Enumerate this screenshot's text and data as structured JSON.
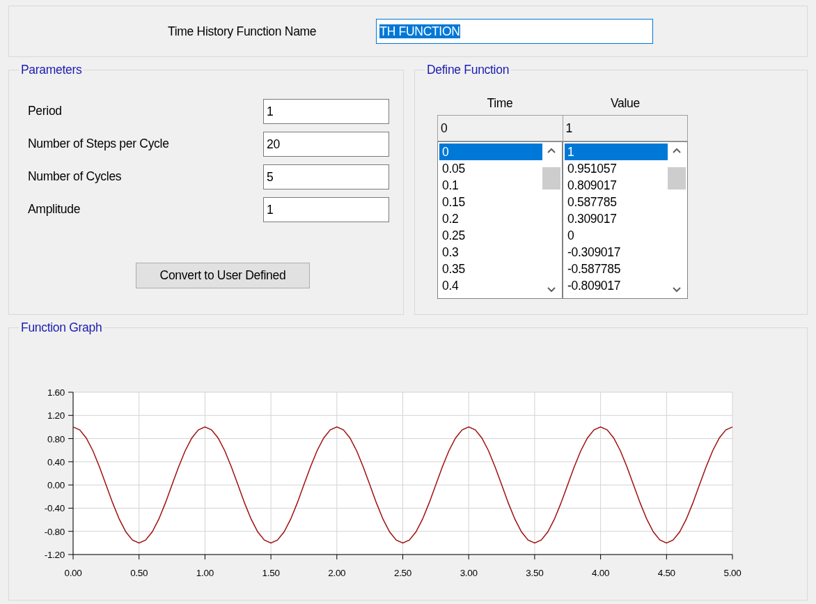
{
  "name_row": {
    "label": "Time History Function Name",
    "value": "TH FUNCTION",
    "focused": true,
    "text_selected": true
  },
  "parameters": {
    "title": "Parameters",
    "fields": [
      {
        "label": "Period",
        "value": "1"
      },
      {
        "label": "Number of Steps per Cycle",
        "value": "20"
      },
      {
        "label": "Number of Cycles",
        "value": "5"
      },
      {
        "label": "Amplitude",
        "value": "1"
      }
    ],
    "button": "Convert to User Defined"
  },
  "define_function": {
    "title": "Define Function",
    "columns": [
      "Time",
      "Value"
    ],
    "edit_row": [
      "0",
      "1"
    ],
    "time_list": [
      {
        "text": "0",
        "selected": true
      },
      {
        "text": "0.05",
        "selected": false
      },
      {
        "text": "0.1",
        "selected": false
      },
      {
        "text": "0.15",
        "selected": false
      },
      {
        "text": "0.2",
        "selected": false
      },
      {
        "text": "0.25",
        "selected": false
      },
      {
        "text": "0.3",
        "selected": false
      },
      {
        "text": "0.35",
        "selected": false
      },
      {
        "text": "0.4",
        "selected": false
      }
    ],
    "value_list": [
      {
        "text": "1",
        "selected": true
      },
      {
        "text": "0.951057",
        "selected": false
      },
      {
        "text": "0.809017",
        "selected": false
      },
      {
        "text": "0.587785",
        "selected": false
      },
      {
        "text": "0.309017",
        "selected": false
      },
      {
        "text": "0",
        "selected": false
      },
      {
        "text": "-0.309017",
        "selected": false
      },
      {
        "text": "-0.587785",
        "selected": false
      },
      {
        "text": "-0.809017",
        "selected": false
      }
    ]
  },
  "function_graph": {
    "title": "Function Graph",
    "chart_data": {
      "type": "line",
      "x": [
        0,
        0.05,
        0.1,
        0.15,
        0.2,
        0.25,
        0.3,
        0.35,
        0.4,
        0.45,
        0.5,
        0.55,
        0.6,
        0.65,
        0.7,
        0.75,
        0.8,
        0.85,
        0.9,
        0.95,
        1,
        1.05,
        1.1,
        1.15,
        1.2,
        1.25,
        1.3,
        1.35,
        1.4,
        1.45,
        1.5,
        1.55,
        1.6,
        1.65,
        1.7,
        1.75,
        1.8,
        1.85,
        1.9,
        1.95,
        2,
        2.05,
        2.1,
        2.15,
        2.2,
        2.25,
        2.3,
        2.35,
        2.4,
        2.45,
        2.5,
        2.55,
        2.6,
        2.65,
        2.7,
        2.75,
        2.8,
        2.85,
        2.9,
        2.95,
        3,
        3.05,
        3.1,
        3.15,
        3.2,
        3.25,
        3.3,
        3.35,
        3.4,
        3.45,
        3.5,
        3.55,
        3.6,
        3.65,
        3.7,
        3.75,
        3.8,
        3.85,
        3.9,
        3.95,
        4,
        4.05,
        4.1,
        4.15,
        4.2,
        4.25,
        4.3,
        4.35,
        4.4,
        4.45,
        4.5,
        4.55,
        4.6,
        4.65,
        4.7,
        4.75,
        4.8,
        4.85,
        4.9,
        4.95,
        5
      ],
      "grid": true,
      "series": [
        {
          "color": "#a01010",
          "values": [
            1,
            0.95,
            0.81,
            0.59,
            0.31,
            0,
            -0.31,
            -0.59,
            -0.81,
            -0.95,
            -1,
            -0.95,
            -0.81,
            -0.59,
            -0.31,
            0,
            0.31,
            0.59,
            0.81,
            0.95,
            1,
            0.95,
            0.81,
            0.59,
            0.31,
            0,
            -0.31,
            -0.59,
            -0.81,
            -0.95,
            -1,
            -0.95,
            -0.81,
            -0.59,
            -0.31,
            0,
            0.31,
            0.59,
            0.81,
            0.95,
            1,
            0.95,
            0.81,
            0.59,
            0.31,
            0,
            -0.31,
            -0.59,
            -0.81,
            -0.95,
            -1,
            -0.95,
            -0.81,
            -0.59,
            -0.31,
            0,
            0.31,
            0.59,
            0.81,
            0.95,
            1,
            0.95,
            0.81,
            0.59,
            0.31,
            0,
            -0.31,
            -0.59,
            -0.81,
            -0.95,
            -1,
            -0.95,
            -0.81,
            -0.59,
            -0.31,
            0,
            0.31,
            0.59,
            0.81,
            0.95,
            1,
            0.95,
            0.81,
            0.59,
            0.31,
            0,
            -0.31,
            -0.59,
            -0.81,
            -0.95,
            -1,
            -0.95,
            -0.81,
            -0.59,
            -0.31,
            0,
            0.31,
            0.59,
            0.81,
            0.95,
            1
          ]
        }
      ],
      "xlim": [
        0,
        5
      ],
      "ylim": [
        -1.2,
        1.6
      ],
      "xticks": [
        {
          "value": 0,
          "label": "0.00"
        },
        {
          "value": 0.5,
          "label": "0.50"
        },
        {
          "value": 1,
          "label": "1.00"
        },
        {
          "value": 1.5,
          "label": "1.50"
        },
        {
          "value": 2,
          "label": "2.00"
        },
        {
          "value": 2.5,
          "label": "2.50"
        },
        {
          "value": 3,
          "label": "3.00"
        },
        {
          "value": 3.5,
          "label": "3.50"
        },
        {
          "value": 4,
          "label": "4.00"
        },
        {
          "value": 4.5,
          "label": "4.50"
        },
        {
          "value": 5,
          "label": "5.00"
        }
      ],
      "yticks": [
        {
          "value": -1.2,
          "label": "-1.20"
        },
        {
          "value": -0.8,
          "label": "-0.80"
        },
        {
          "value": -0.4,
          "label": "-0.40"
        },
        {
          "value": 0,
          "label": "0.00"
        },
        {
          "value": 0.4,
          "label": "0.40"
        },
        {
          "value": 0.8,
          "label": "0.80"
        },
        {
          "value": 1.2,
          "label": "1.20"
        },
        {
          "value": 1.6,
          "label": "1.60"
        }
      ]
    }
  }
}
